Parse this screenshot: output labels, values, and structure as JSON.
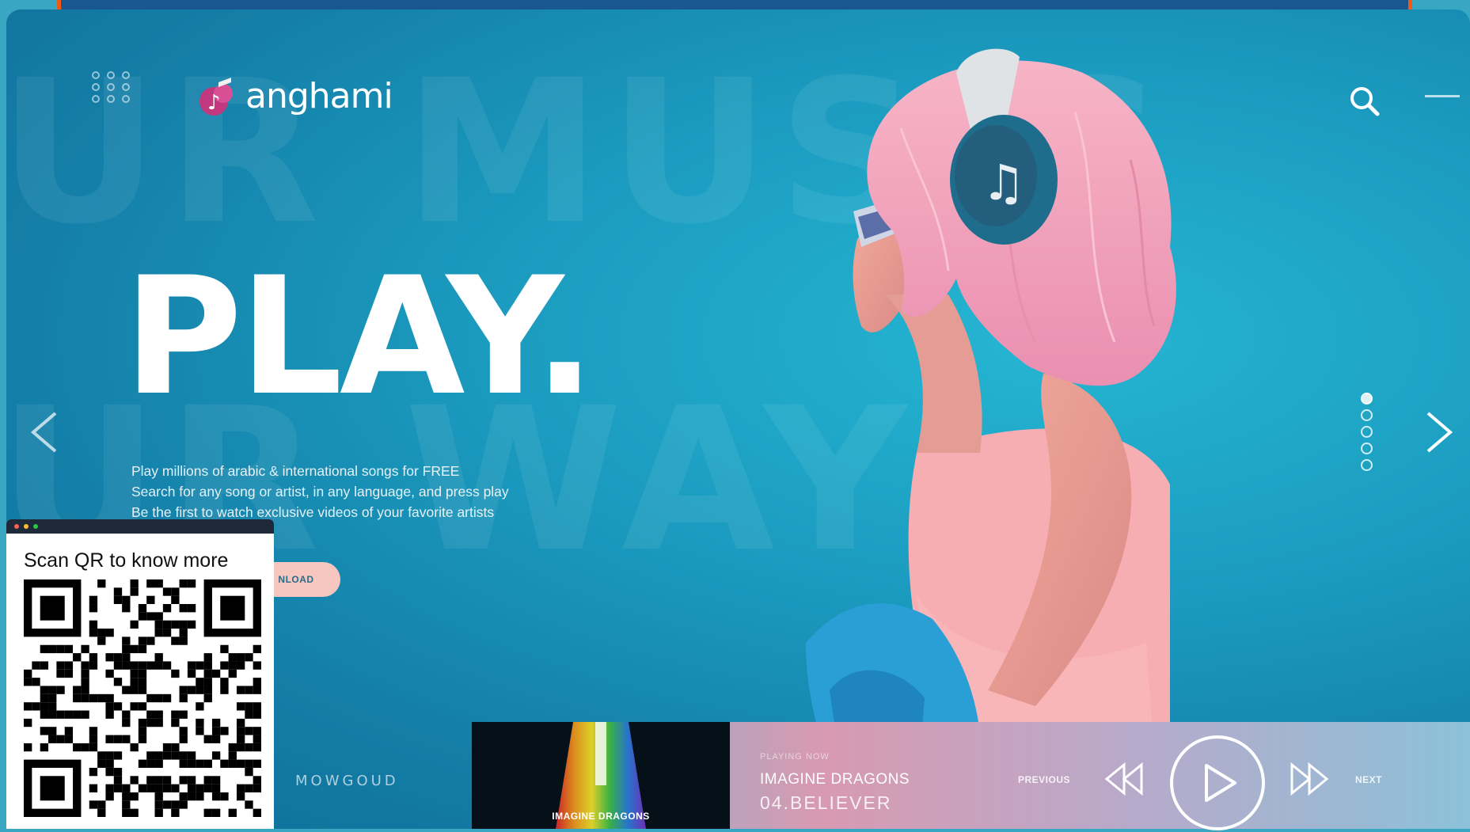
{
  "header": {
    "logo_text": "anghami",
    "search_icon": "search-icon",
    "menu_icon": "menu-icon",
    "apps_icon": "dots-grid-icon"
  },
  "background_words": {
    "line1": "UR MUSIC",
    "line2": "UR WAY"
  },
  "hero": {
    "headline": "PLAY.",
    "lines": [
      "Play millions of arabic & international songs for FREE",
      "Search for any song or artist, in any language, and press play",
      "Be the first to watch exclusive videos of your favorite artists"
    ],
    "button_label": "NLOAD"
  },
  "carousel": {
    "prev_icon": "chevron-left-icon",
    "next_icon": "chevron-right-icon",
    "slide_count": 5,
    "active_slide": 1
  },
  "player": {
    "left_label": "MOWGOUD",
    "album_caption": "IMAGINE DRAGONS",
    "now_playing_label": "PLAYING NOW",
    "artist": "IMAGINE DRAGONS",
    "track": "04.BELIEVER",
    "previous_label": "PREVIOUS",
    "next_label": "NEXT"
  },
  "qr": {
    "title": "Scan QR to know more"
  },
  "colors": {
    "topbar": "#1a5790",
    "topbar_border": "#f05a12",
    "brand_pink": "#c2387e",
    "hair_pink": "#f3a9bd",
    "background": "#1b9bbf"
  }
}
